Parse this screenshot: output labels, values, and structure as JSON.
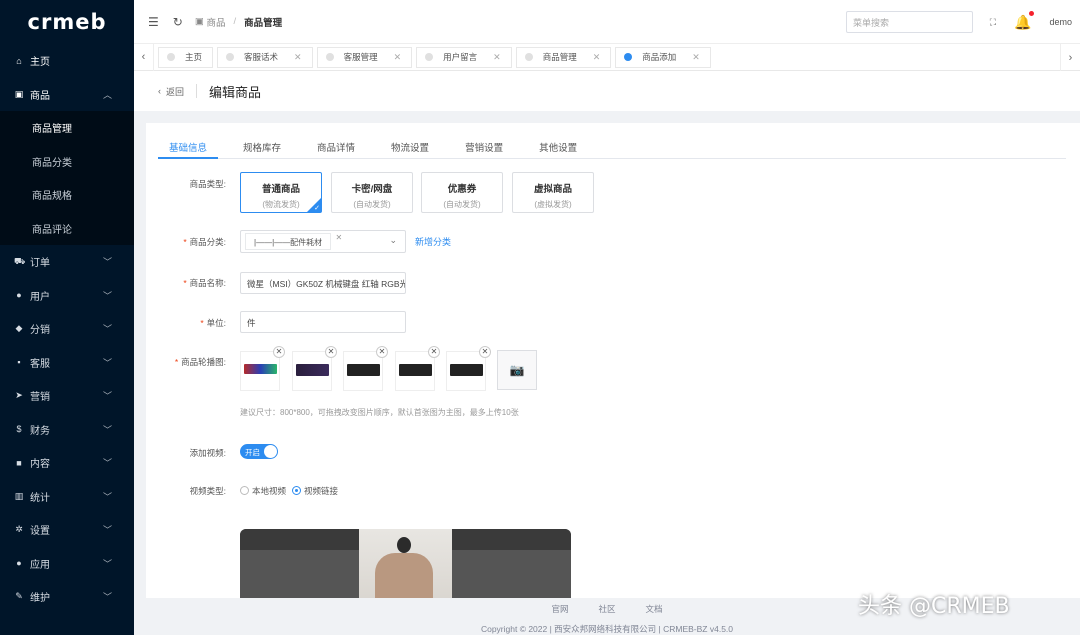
{
  "brand": {
    "logo": "crmeb"
  },
  "sidebar": {
    "items": [
      {
        "label": "主页",
        "icon": "home-icon"
      },
      {
        "label": "商品",
        "icon": "shop-icon"
      },
      {
        "label": "订单",
        "icon": "cart-icon"
      },
      {
        "label": "用户",
        "icon": "user-icon"
      },
      {
        "label": "分销",
        "icon": "share-icon"
      },
      {
        "label": "客服",
        "icon": "chat-icon"
      },
      {
        "label": "营销",
        "icon": "send-icon"
      },
      {
        "label": "财务",
        "icon": "dollar-icon"
      },
      {
        "label": "内容",
        "icon": "doc-icon"
      },
      {
        "label": "统计",
        "icon": "stats-icon"
      },
      {
        "label": "设置",
        "icon": "gear-icon"
      },
      {
        "label": "应用",
        "icon": "app-icon"
      },
      {
        "label": "维护",
        "icon": "wrench-icon"
      }
    ],
    "submenu": [
      "商品管理",
      "商品分类",
      "商品规格",
      "商品评论"
    ]
  },
  "topbar": {
    "breadcrumb_parent": "商品",
    "breadcrumb_current": "商品管理",
    "search_placeholder": "菜单搜索",
    "user": "demo"
  },
  "tabs": [
    {
      "label": "主页",
      "closable": false
    },
    {
      "label": "客服话术",
      "closable": true
    },
    {
      "label": "客服管理",
      "closable": true
    },
    {
      "label": "用户留言",
      "closable": true
    },
    {
      "label": "商品管理",
      "closable": true
    },
    {
      "label": "商品添加",
      "closable": true,
      "active": true
    }
  ],
  "page": {
    "back": "返回",
    "title": "编辑商品"
  },
  "form_tabs": [
    "基础信息",
    "规格库存",
    "商品详情",
    "物流设置",
    "营销设置",
    "其他设置"
  ],
  "form": {
    "type_label": "商品类型:",
    "types": [
      {
        "title": "普通商品",
        "sub": "(物流发货)",
        "selected": true
      },
      {
        "title": "卡密/网盘",
        "sub": "(自动发货)"
      },
      {
        "title": "优惠券",
        "sub": "(自动发货)"
      },
      {
        "title": "虚拟商品",
        "sub": "(虚拟发货)"
      }
    ],
    "category_label": "商品分类:",
    "category_value": "|——|——配件耗材",
    "add_category": "新增分类",
    "name_label": "商品名称:",
    "name_value": "微星（MSI）GK50Z 机械键盘 红轴 RGB光",
    "unit_label": "单位:",
    "unit_value": "件",
    "images_label": "商品轮播图:",
    "images_hint": "建议尺寸：800*800，可拖拽改变图片顺序，默认首张图为主图，最多上传10张",
    "video_label": "添加视频:",
    "video_switch": "开启",
    "video_type_label": "视频类型:",
    "video_type_options": [
      "本地视频",
      "视频链接"
    ],
    "video_type_selected": 1
  },
  "footer": {
    "links": [
      "官网",
      "社区",
      "文档"
    ],
    "copyright": "Copyright © 2022 | 西安众邦网络科技有限公司 | CRMEB-BZ v4.5.0"
  },
  "watermark": "头条 @CRMEB"
}
